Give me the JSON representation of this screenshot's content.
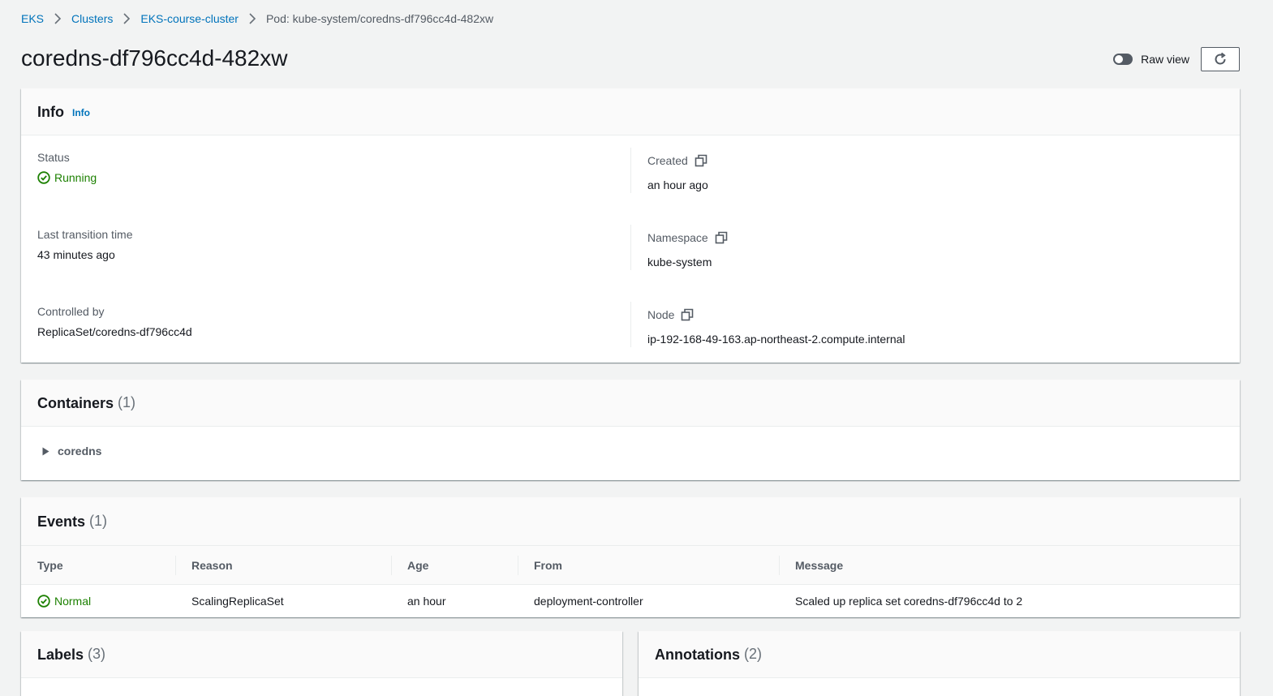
{
  "breadcrumb": {
    "items": [
      "EKS",
      "Clusters",
      "EKS-course-cluster"
    ],
    "current": "Pod: kube-system/coredns-df796cc4d-482xw"
  },
  "page": {
    "title": "coredns-df796cc4d-482xw",
    "raw_view_label": "Raw view"
  },
  "info": {
    "title": "Info",
    "info_link": "Info",
    "status_label": "Status",
    "status_value": "Running",
    "last_transition_label": "Last transition time",
    "last_transition_value": "43 minutes ago",
    "controlled_by_label": "Controlled by",
    "controlled_by_value": "ReplicaSet/coredns-df796cc4d",
    "created_label": "Created",
    "created_value": "an hour ago",
    "namespace_label": "Namespace",
    "namespace_value": "kube-system",
    "node_label": "Node",
    "node_value": "ip-192-168-49-163.ap-northeast-2.compute.internal"
  },
  "containers": {
    "title": "Containers",
    "count": "(1)",
    "items": [
      "coredns"
    ]
  },
  "events": {
    "title": "Events",
    "count": "(1)",
    "columns": [
      "Type",
      "Reason",
      "Age",
      "From",
      "Message"
    ],
    "rows": [
      {
        "type": "Normal",
        "reason": "ScalingReplicaSet",
        "age": "an hour",
        "from": "deployment-controller",
        "message": "Scaled up replica set coredns-df796cc4d to 2"
      }
    ]
  },
  "labels": {
    "title": "Labels",
    "count": "(3)"
  },
  "annotations": {
    "title": "Annotations",
    "count": "(2)"
  },
  "colors": {
    "link": "#0073bb",
    "success": "#1d8102",
    "background": "#f2f3f3"
  }
}
